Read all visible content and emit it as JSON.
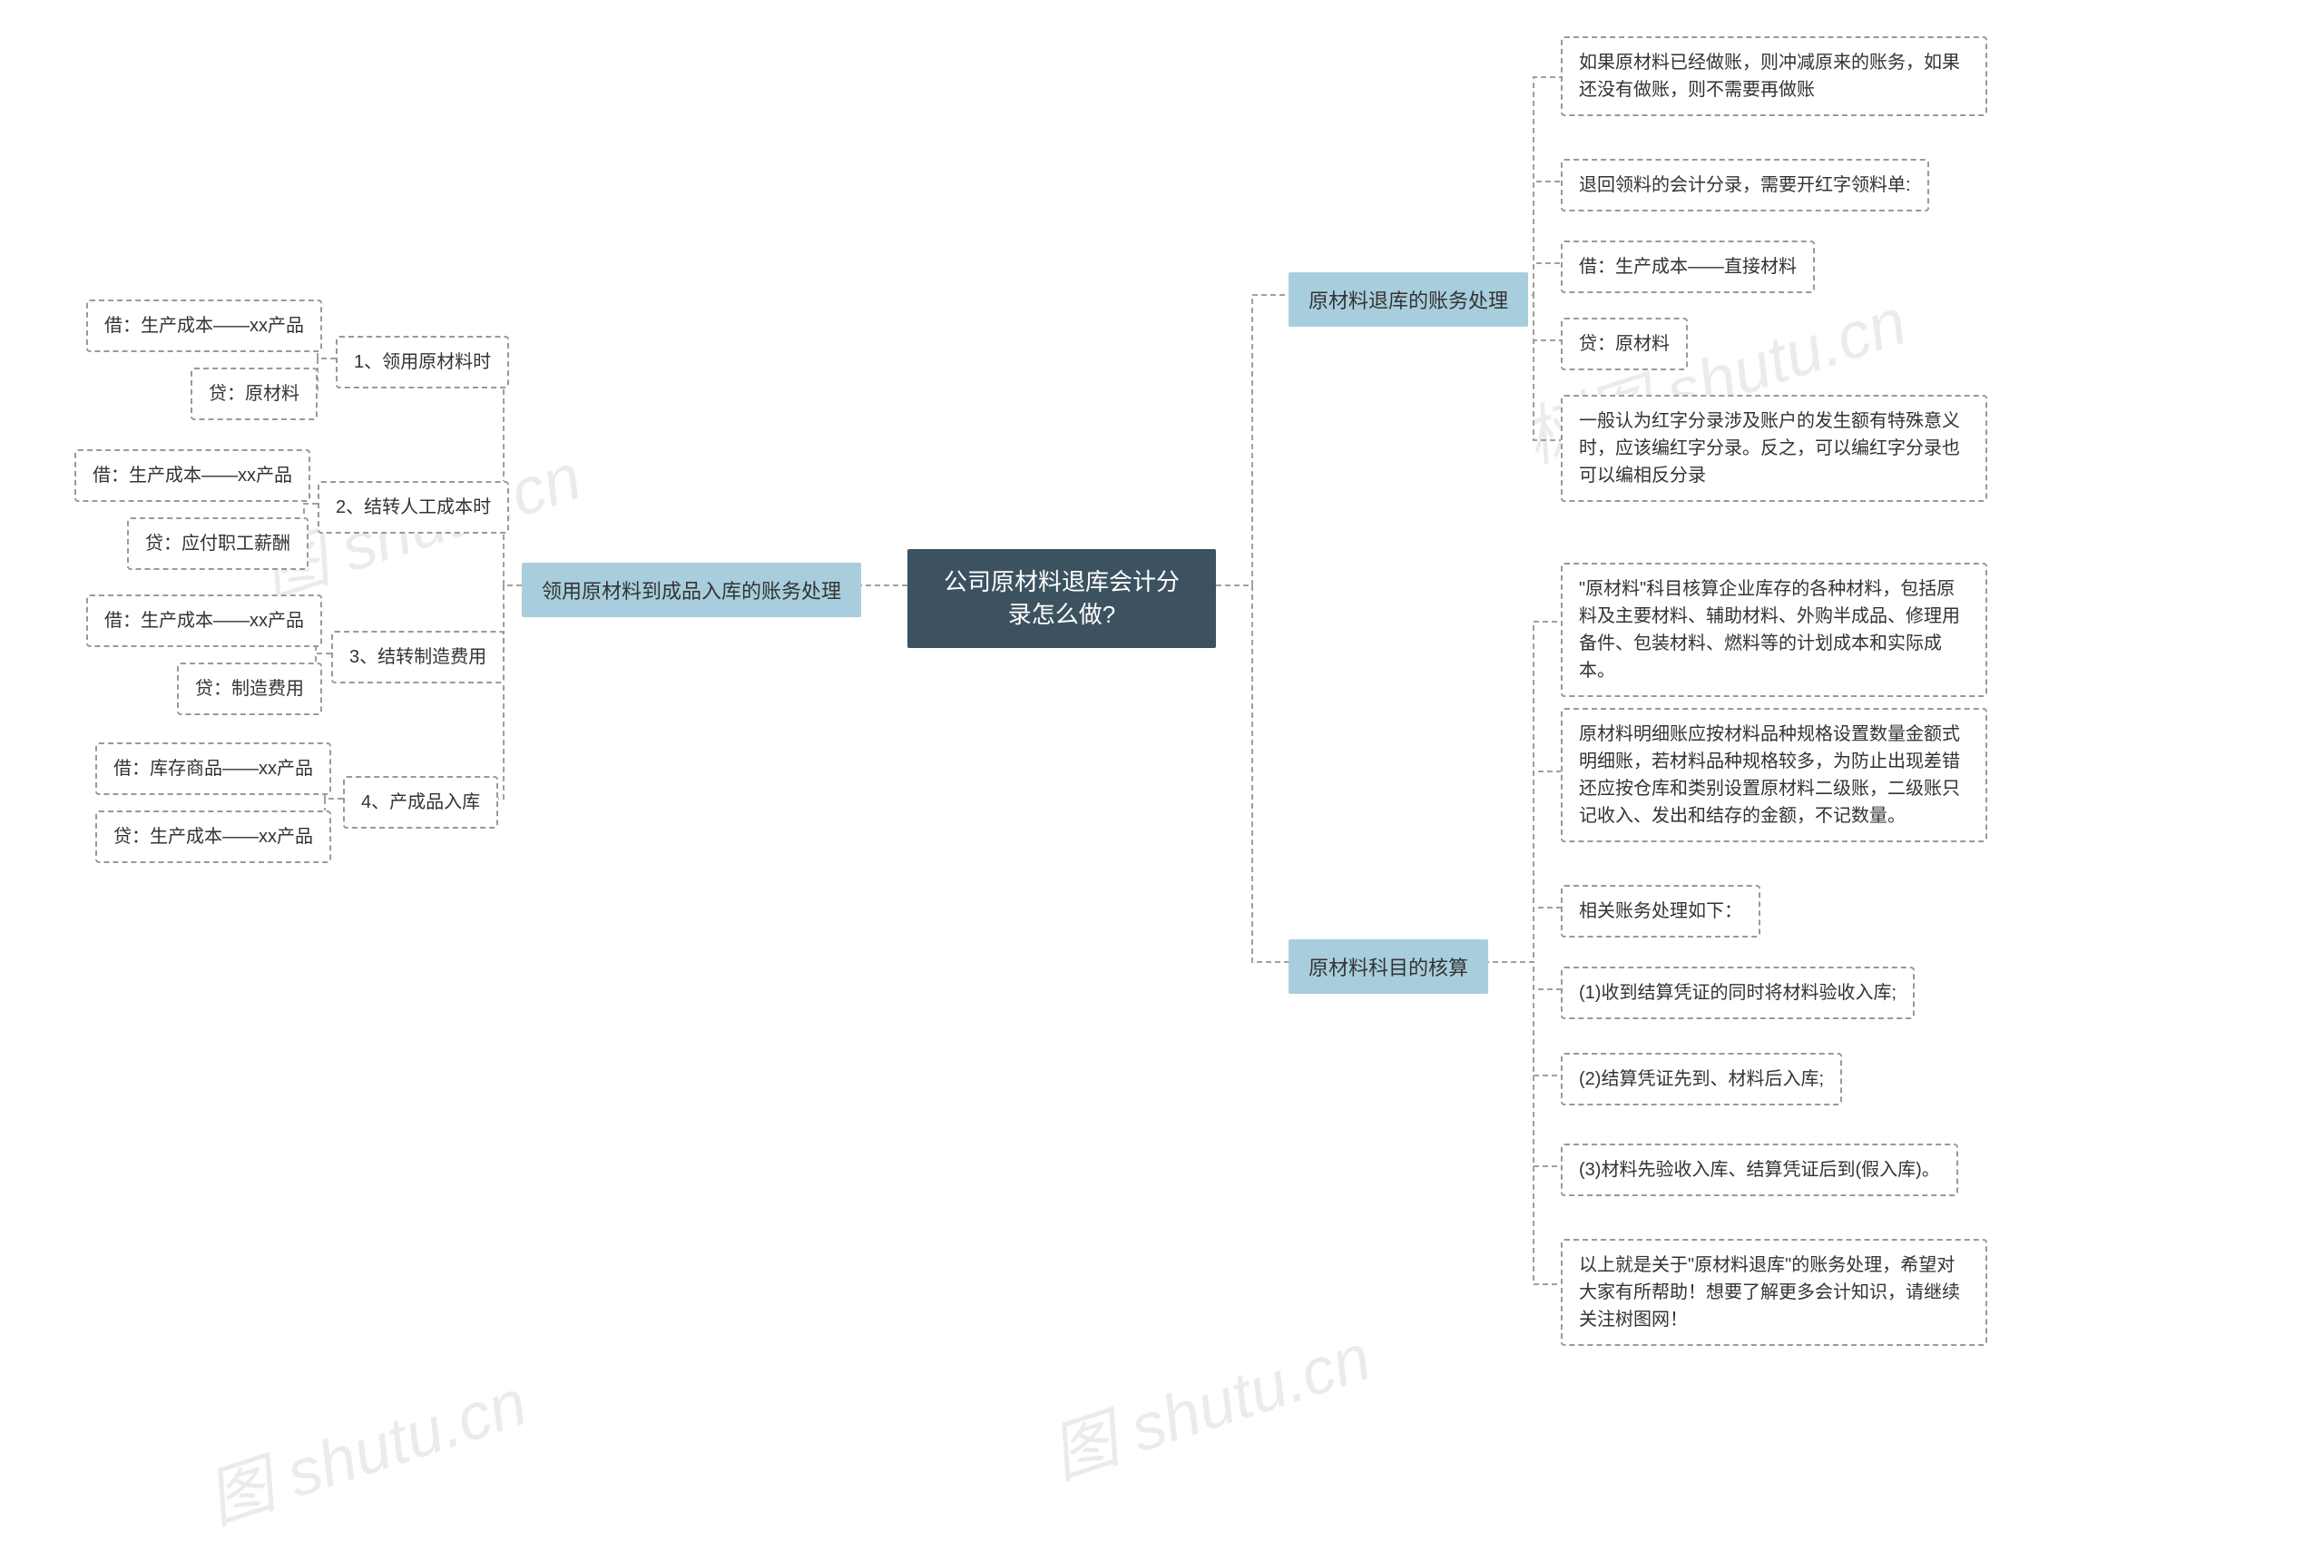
{
  "watermarks": {
    "w1": "图 shutu.cn",
    "w2": "树图 shutu.cn",
    "w3": "图 shutu.cn",
    "w4": "图 shutu.cn"
  },
  "root": {
    "title": "公司原材料退库会计分录怎么做?"
  },
  "right": {
    "branch1": {
      "label": "原材料退库的账务处理",
      "leaves": {
        "l1": "如果原材料已经做账，则冲减原来的账务，如果还没有做账，则不需要再做账",
        "l2": "退回领料的会计分录，需要开红字领料单:",
        "l3": "借：生产成本——直接材料",
        "l4": "贷：原材料",
        "l5": "一般认为红字分录涉及账户的发生额有特殊意义时，应该编红字分录。反之，可以编红字分录也可以编相反分录"
      }
    },
    "branch2": {
      "label": "原材料科目的核算",
      "leaves": {
        "l1": "\"原材料\"科目核算企业库存的各种材料，包括原料及主要材料、辅助材料、外购半成品、修理用备件、包装材料、燃料等的计划成本和实际成本。",
        "l2": "原材料明细账应按材料品种规格设置数量金额式明细账，若材料品种规格较多，为防止出现差错还应按仓库和类别设置原材料二级账，二级账只记收入、发出和结存的金额，不记数量。",
        "l3": "相关账务处理如下：",
        "l4": "(1)收到结算凭证的同时将材料验收入库;",
        "l5": "(2)结算凭证先到、材料后入库;",
        "l6": "(3)材料先验收入库、结算凭证后到(假入库)。",
        "l7": "以上就是关于\"原材料退库\"的账务处理，希望对大家有所帮助！想要了解更多会计知识，请继续关注树图网！"
      }
    }
  },
  "left": {
    "branch": {
      "label": "领用原材料到成品入库的账务处理",
      "steps": {
        "s1": {
          "label": "1、领用原材料时",
          "entries": {
            "debit": "借：生产成本——xx产品",
            "credit": "贷：原材料"
          }
        },
        "s2": {
          "label": "2、结转人工成本时",
          "entries": {
            "debit": "借：生产成本——xx产品",
            "credit": "贷：应付职工薪酬"
          }
        },
        "s3": {
          "label": "3、结转制造费用",
          "entries": {
            "debit": "借：生产成本——xx产品",
            "credit": "贷：制造费用"
          }
        },
        "s4": {
          "label": "4、产成品入库",
          "entries": {
            "debit": "借：库存商品——xx产品",
            "credit": "贷：生产成本——xx产品"
          }
        }
      }
    }
  }
}
